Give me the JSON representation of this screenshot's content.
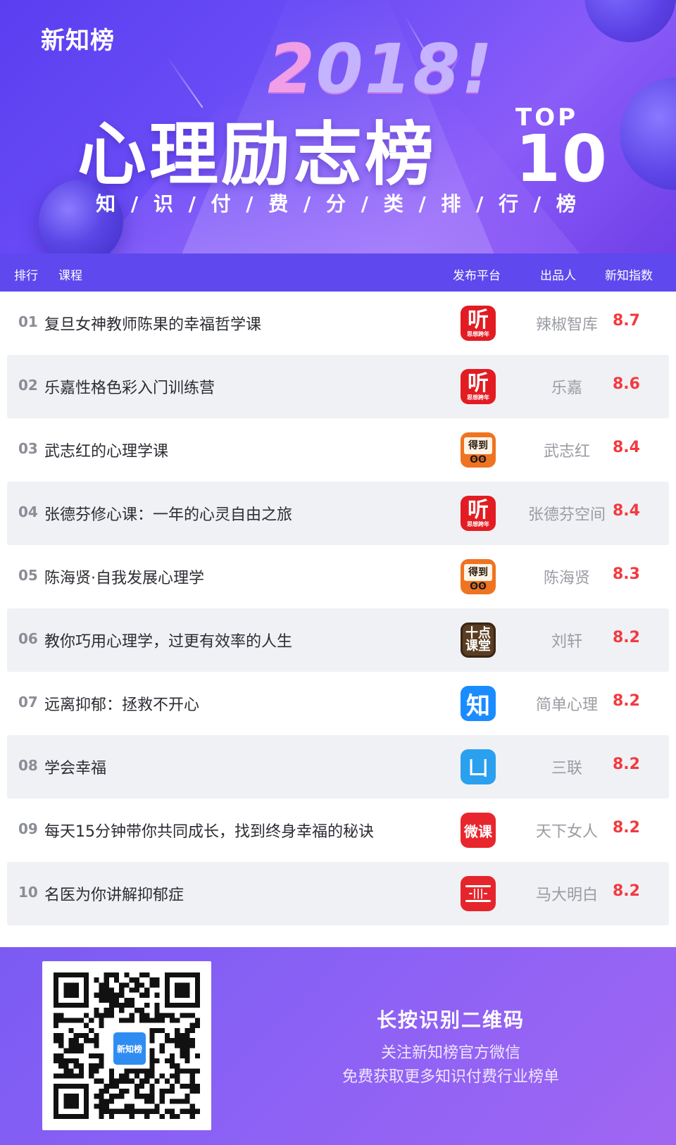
{
  "hero": {
    "brand": "新知榜",
    "year": "2018!",
    "title": "心理励志榜",
    "top_label": "TOP",
    "top_number": "10",
    "subtitle": "知 / 识 / 付 / 费 / 分 / 类 / 排 / 行 / 榜"
  },
  "table": {
    "headers": {
      "rank": "排行",
      "course": "课程",
      "platform": "发布平台",
      "publisher": "出品人",
      "score": "新知指数"
    },
    "rows": [
      {
        "rank": "01",
        "course": "复旦女神教师陈果的幸福哲学课",
        "platform": "ting-icon",
        "publisher": "辣椒智库",
        "score": "8.7"
      },
      {
        "rank": "02",
        "course": "乐嘉性格色彩入门训练营",
        "platform": "ting-icon",
        "publisher": "乐嘉",
        "score": "8.6"
      },
      {
        "rank": "03",
        "course": "武志红的心理学课",
        "platform": "dedao-icon",
        "publisher": "武志红",
        "score": "8.4"
      },
      {
        "rank": "04",
        "course": "张德芬修心课：一年的心灵自由之旅",
        "platform": "ting-icon",
        "publisher": "张德芬空间",
        "score": "8.4"
      },
      {
        "rank": "05",
        "course": "陈海贤·自我发展心理学",
        "platform": "dedao-icon",
        "publisher": "陈海贤",
        "score": "8.3"
      },
      {
        "rank": "06",
        "course": "教你巧用心理学，过更有效率的人生",
        "platform": "shidian-ketang-icon",
        "publisher": "刘轩",
        "score": "8.2"
      },
      {
        "rank": "07",
        "course": "远离抑郁：拯救不开心",
        "platform": "zhihu-icon",
        "publisher": "简单心理",
        "score": "8.2"
      },
      {
        "rank": "08",
        "course": "学会幸福",
        "platform": "sanlian-icon",
        "publisher": "三联",
        "score": "8.2"
      },
      {
        "rank": "09",
        "course": "每天15分钟带你共同成长，找到终身幸福的秘诀",
        "platform": "weike-icon",
        "publisher": "天下女人",
        "score": "8.2"
      },
      {
        "rank": "10",
        "course": "名医为你讲解抑郁症",
        "platform": "audio-icon",
        "publisher": "马大明白",
        "score": "8.2"
      }
    ]
  },
  "icons": {
    "ting_big": "听",
    "ting_small": "思想跨年",
    "dedao_board": "得到",
    "dedao_owl": "ʘʘ",
    "shi_top": "十点",
    "shi_bottom": "课堂",
    "zhi": "知",
    "san": "凵",
    "wei": "微课",
    "audio_wave": "-|||-"
  },
  "footer": {
    "qr_logo": "新知榜",
    "title": "长按识别二维码",
    "line1": "关注新知榜官方微信",
    "line2": "免费获取更多知识付费行业榜单"
  },
  "colors": {
    "accent": "#5e48ee",
    "score": "#f23a40",
    "alt_row": "#f0f1f5"
  }
}
